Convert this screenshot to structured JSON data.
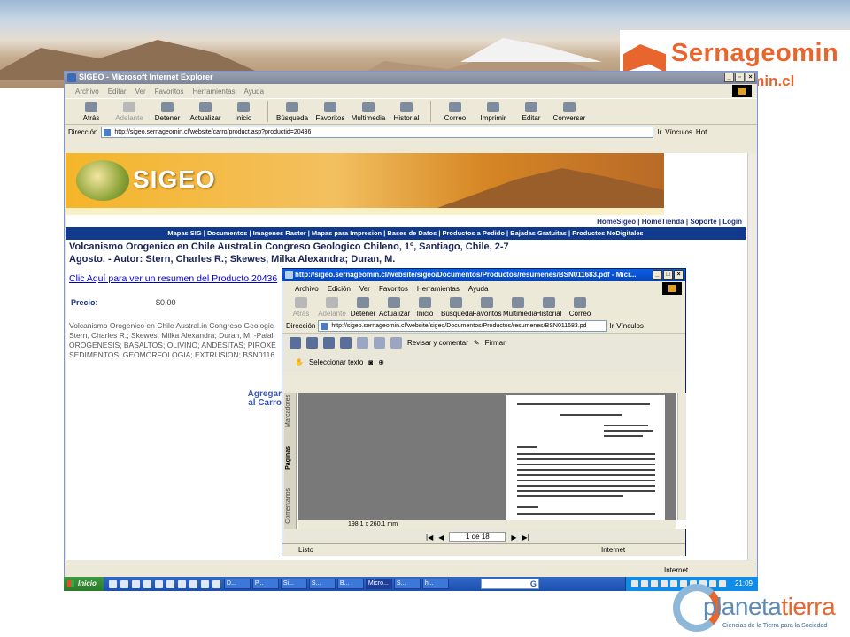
{
  "slide": {
    "logo_top_name": "Sernageomin",
    "logo_top_url": "geomin.cl",
    "logo_bottom_name_a": "planeta",
    "logo_bottom_name_b": "tierra",
    "logo_bottom_tagline": "Ciencias de la Tierra para la Sociedad"
  },
  "outer": {
    "title": "SIGEO - Microsoft Internet Explorer",
    "menu": [
      "Archivo",
      "Editar",
      "Ver",
      "Favoritos",
      "Herramientas",
      "Ayuda"
    ],
    "toolbar": [
      "Atrás",
      "Adelante",
      "Detener",
      "Actualizar",
      "Inicio",
      "Búsqueda",
      "Favoritos",
      "Multimedia",
      "Historial",
      "Correo",
      "Imprimir",
      "Editar",
      "Conversar"
    ],
    "address_label": "Dirección",
    "address": "http://sigeo.sernageomin.cl/website/carro/product.asp?productid=20436",
    "go": "Ir",
    "links": "Vínculos",
    "hot": "Hot",
    "status_zone": "Internet"
  },
  "page": {
    "brand": "SIGEO",
    "top_links": "HomeSigeo | HomeTienda | Soporte | Login",
    "nav": "Mapas SIG | Documentos | Imagenes Raster | Mapas para Impresion | Bases de Datos | Productos a Pedido | Bajadas Gratuitas | Productos NoDigitales",
    "title": "Volcanismo Orogenico en Chile Austral.in Congreso Geologico Chileno, 1º, Santiago, Chile, 2-7 Agosto. - Autor: Stern, Charles R.; Skewes, Milka Alexandra; Duran, M.",
    "summary_link": "Clic Aquí para ver un resumen del Producto 20436",
    "price_label": "Precio:",
    "price_value": "$0,00",
    "desc": [
      "Volcanismo Orogenico en Chile Austral.in Congreso Geologic",
      "Stern, Charles R.; Skewes, Milka Alexandra; Duran, M. -Palal",
      "OROGENESIS; BASALTOS; OLIVINO; ANDESITAS; PIROXE",
      "SEDIMENTOS; GEOMORFOLOGIA; EXTRUSION; BSN0116"
    ],
    "add_cart_1": "Agregar",
    "add_cart_2": "al Carro"
  },
  "inner": {
    "title": "http://sigeo.sernageomin.cl/website/sigeo/Documentos/Productos/resumenes/BSN011683.pdf - Micr...",
    "menu": [
      "Archivo",
      "Edición",
      "Ver",
      "Favoritos",
      "Herramientas",
      "Ayuda"
    ],
    "toolbar": [
      "Atrás",
      "Adelante",
      "Detener",
      "Actualizar",
      "Inicio",
      "Búsqueda",
      "Favoritos",
      "Multimedia",
      "Historial",
      "Correo"
    ],
    "address_label": "Dirección",
    "address": "http://sigeo.sernageomin.cl/website/sigeo/Documentos/Productos/resumenes/BSN011683.pd",
    "go": "Ir",
    "links": "Vínculos",
    "review": "Revisar y comentar",
    "sign": "Firmar",
    "select_text": "Seleccionar texto",
    "panel_tabs": [
      "Marcadores",
      "Páginas",
      "Comentarios"
    ],
    "page_size": "198,1 x 260,1 mm",
    "page_counter": "1 de 18",
    "status": "Listo",
    "status_zone": "Internet"
  },
  "taskbar": {
    "start": "Inicio",
    "tasks": [
      "D...",
      "P...",
      "Si...",
      "S...",
      "B...",
      "Micro...",
      "S...",
      "h..."
    ],
    "clock": "21:09"
  }
}
